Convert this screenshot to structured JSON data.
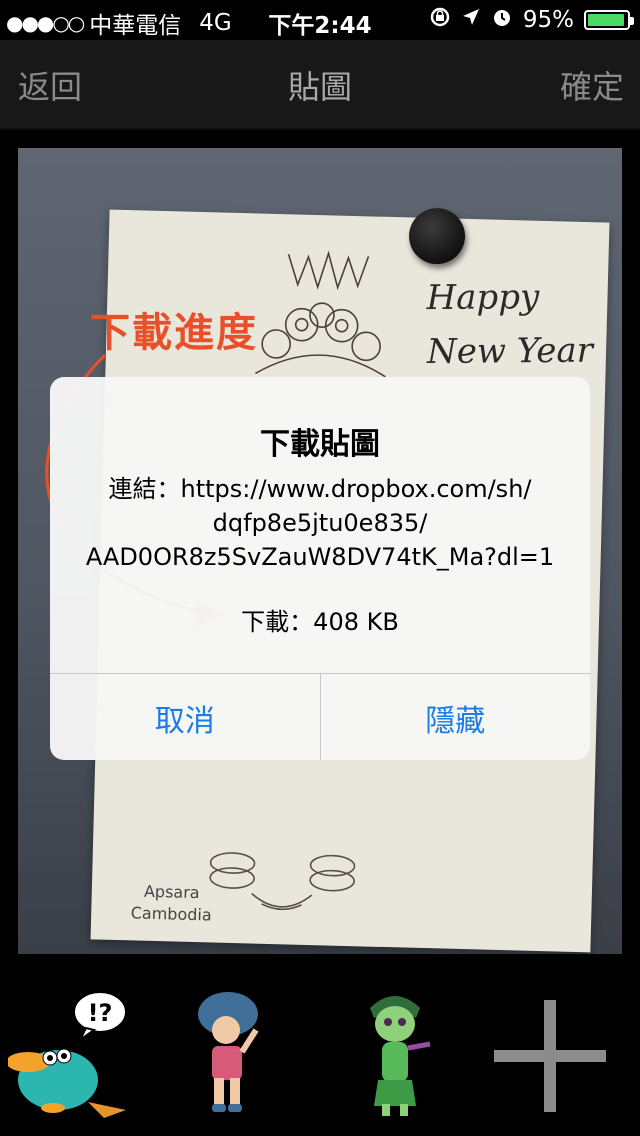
{
  "status_bar": {
    "signal": "●●●○○",
    "carrier": "中華電信",
    "network": "4G",
    "time": "下午2:44",
    "battery_percent": "95%",
    "battery_level": 0.95
  },
  "nav": {
    "back_label": "返回",
    "title": "貼圖",
    "done_label": "確定"
  },
  "photo": {
    "card_greeting": [
      "Happy",
      "New Year"
    ],
    "card_caption": [
      "Apsara",
      "Cambodia"
    ]
  },
  "annotation": {
    "label": "下載進度",
    "color": "#e8502a"
  },
  "alert": {
    "title": "下載貼圖",
    "message_lines": [
      "連結：https://www.dropbox.com/sh/",
      "dqfp8e5jtu0e835/",
      "AAD0OR8z5SvZauW8DV74tK_Ma?dl=1"
    ],
    "size_text": "下載：408 KB",
    "cancel_label": "取消",
    "hide_label": "隱藏",
    "button_color": "#1a7ce6"
  },
  "sticker_tray": {
    "stickers": [
      {
        "name": "perry-platypus-sticker",
        "bubble_text": "!?"
      },
      {
        "name": "boo-girl-sticker"
      },
      {
        "name": "disgust-sticker"
      }
    ],
    "add_icon": "plus-icon"
  }
}
